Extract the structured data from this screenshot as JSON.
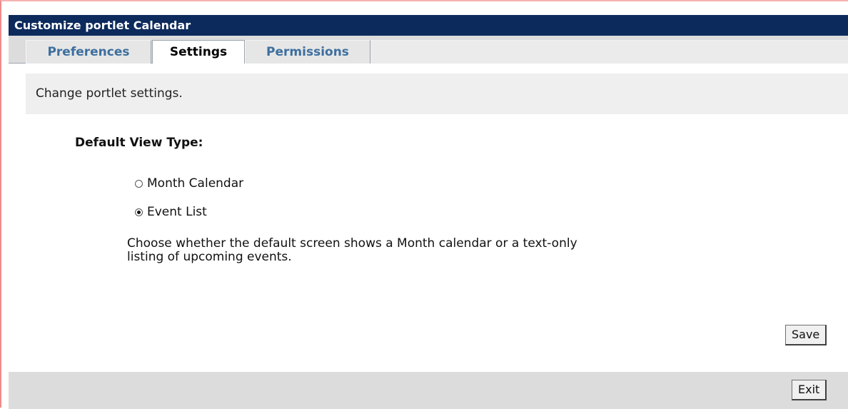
{
  "window": {
    "title": "Customize portlet Calendar"
  },
  "tabs": [
    {
      "label": "Preferences",
      "active": false
    },
    {
      "label": "Settings",
      "active": true
    },
    {
      "label": "Permissions",
      "active": false
    }
  ],
  "info": {
    "text": "Change portlet settings."
  },
  "setting": {
    "label": "Default View Type:",
    "options": [
      {
        "label": "Month Calendar",
        "checked": false
      },
      {
        "label": "Event List",
        "checked": true
      }
    ],
    "help_line1": "Choose whether the default screen shows a Month calendar or a text-only",
    "help_line2": "listing of upcoming events."
  },
  "buttons": {
    "save": "Save",
    "exit": "Exit"
  },
  "colors": {
    "titlebar": "#0c2a5c",
    "tab_inactive_text": "#3d6f9e",
    "frame_border": "#f08a8a"
  }
}
